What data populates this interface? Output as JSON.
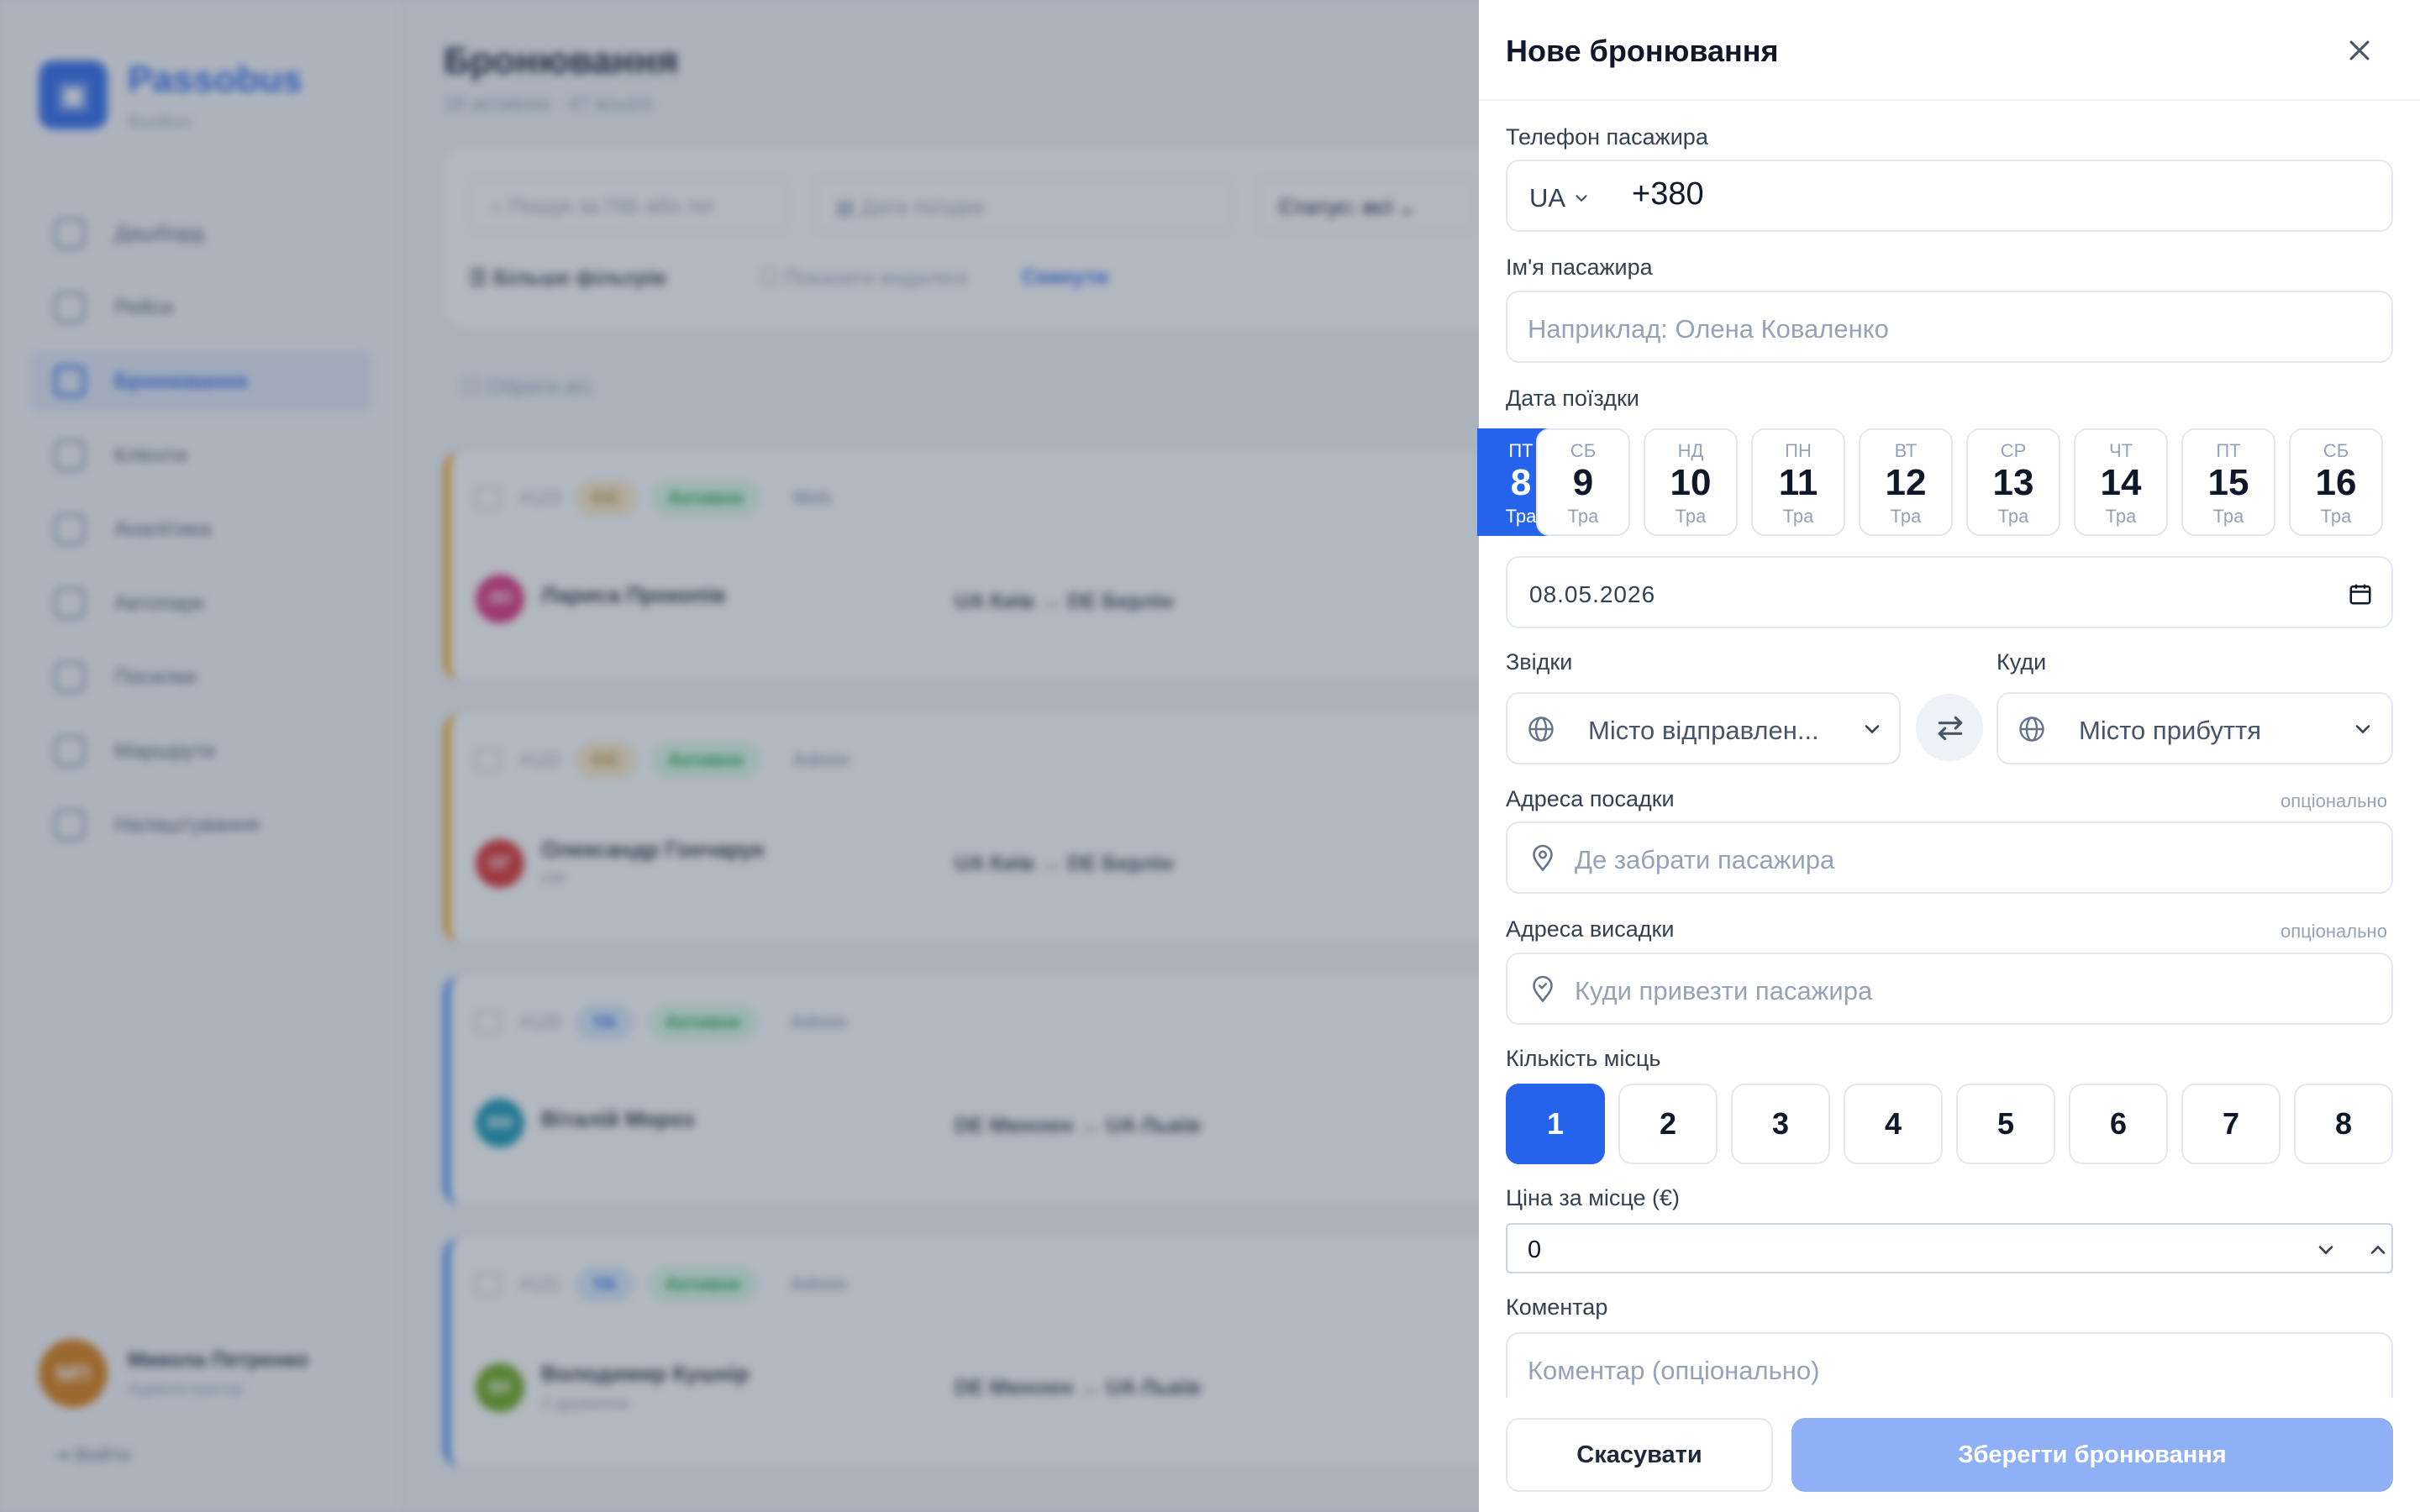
{
  "app": {
    "name": "Passobus",
    "subtitle": "BusBus",
    "logo_icon": "bus-icon"
  },
  "sidebar": {
    "items": [
      {
        "label": "Дашборд",
        "icon": "dashboard-icon"
      },
      {
        "label": "Рейси",
        "icon": "bus-icon"
      },
      {
        "label": "Бронювання",
        "icon": "document-icon",
        "active": true
      },
      {
        "label": "Клієнти",
        "icon": "users-icon"
      },
      {
        "label": "Аналітика",
        "icon": "chart-icon"
      },
      {
        "label": "Автопарк",
        "icon": "truck-icon"
      },
      {
        "label": "Посилки",
        "icon": "package-icon"
      },
      {
        "label": "Маршрути",
        "icon": "route-icon"
      },
      {
        "label": "Налаштування",
        "icon": "gear-icon"
      }
    ],
    "user": {
      "initials": "МП",
      "name": "Микола Петренко",
      "role": "Адміністратор"
    },
    "logout": "Вийти"
  },
  "main": {
    "title": "Бронювання",
    "subtitle": "19 активних · 47 всього",
    "search_placeholder": "Пошук за ПІБ або тег",
    "date_placeholder": "Дата поїздки",
    "status": "Статус: всі",
    "more_filters": "Більше фільтрів",
    "show_deleted": "Показати видалені",
    "reset": "Скинути",
    "select_all": "Обрати всі",
    "bookings": [
      {
        "id": "#123",
        "tag": "CC",
        "status": "Активне",
        "source": "Web",
        "initials": "ЛП",
        "name": "Лариса Прокопів",
        "note": "",
        "route": "UA Київ → DE Берлін",
        "color": "#db2777"
      },
      {
        "id": "#122",
        "tag": "CC",
        "status": "Активне",
        "source": "Admin",
        "initials": "ОГ",
        "name": "Олександр Гончарук",
        "note": "VIP",
        "route": "UA Київ → DE Берлін",
        "color": "#dc2626"
      },
      {
        "id": "#120",
        "tag": "YA",
        "status": "Активне",
        "source": "Admin",
        "initials": "ВМ",
        "name": "Віталій Мороз",
        "note": "",
        "route": "DE Мюнхен → UA Львів",
        "color": "#0891b2"
      },
      {
        "id": "#121",
        "tag": "YA",
        "status": "Активне",
        "source": "Admin",
        "initials": "ВК",
        "name": "Володимир Кушнір",
        "note": "З дружиною",
        "route": "DE Мюнхен → UA Львів",
        "color": "#65a30d"
      }
    ]
  },
  "drawer": {
    "title": "Нове бронювання",
    "phone_label": "Телефон пасажира",
    "phone_country": "UA",
    "phone_value": "+380",
    "name_label": "Ім'я пасажира",
    "name_placeholder": "Наприклад: Олена Коваленко",
    "date_label": "Дата поїздки",
    "dates": [
      {
        "dow": "ПТ",
        "day": "8",
        "month": "Тра",
        "selected": true
      },
      {
        "dow": "СБ",
        "day": "9",
        "month": "Тра"
      },
      {
        "dow": "НД",
        "day": "10",
        "month": "Тра"
      },
      {
        "dow": "ПН",
        "day": "11",
        "month": "Тра"
      },
      {
        "dow": "ВТ",
        "day": "12",
        "month": "Тра"
      },
      {
        "dow": "СР",
        "day": "13",
        "month": "Тра"
      },
      {
        "dow": "ЧТ",
        "day": "14",
        "month": "Тра"
      },
      {
        "dow": "ПТ",
        "day": "15",
        "month": "Тра"
      },
      {
        "dow": "СБ",
        "day": "16",
        "month": "Тра"
      }
    ],
    "date_value": "08.05.2026",
    "from_label": "Звідки",
    "from_placeholder": "Місто відправлен...",
    "to_label": "Куди",
    "to_placeholder": "Місто прибуття",
    "pickup_label": "Адреса посадки",
    "pickup_placeholder": "Де забрати пасажира",
    "dropoff_label": "Адреса висадки",
    "dropoff_placeholder": "Куди привезти пасажира",
    "optional": "опціонально",
    "seats_label": "Кількість місць",
    "seats": [
      "1",
      "2",
      "3",
      "4",
      "5",
      "6",
      "7",
      "8"
    ],
    "seats_selected": "1",
    "price_label": "Ціна за місце (€)",
    "price_value": "0",
    "comment_label": "Коментар",
    "comment_placeholder": "Коментар (опціонально)",
    "cancel": "Скасувати",
    "save": "Зберегти бронювання"
  }
}
